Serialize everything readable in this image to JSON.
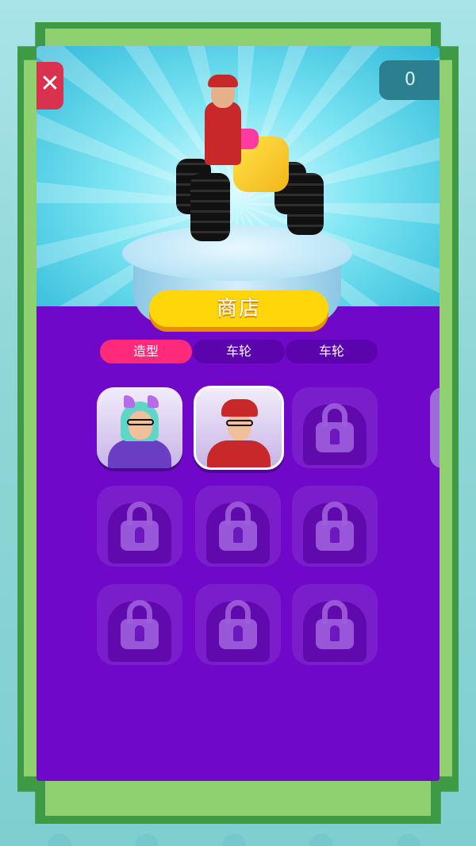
{
  "header": {
    "close_label": "✕",
    "coin_count": "0"
  },
  "shop": {
    "title": "商店"
  },
  "tabs": [
    {
      "label": "造型",
      "active": true
    },
    {
      "label": "车轮",
      "active": false
    },
    {
      "label": "车轮",
      "active": false
    }
  ],
  "grid": {
    "rows": 3,
    "cols": 3,
    "items": [
      {
        "state": "unlocked",
        "icon": "character-avatar-teal-hair-headphones",
        "selected": false
      },
      {
        "state": "unlocked",
        "icon": "character-avatar-red-cap",
        "selected": true
      },
      {
        "state": "locked",
        "icon": "lock-icon"
      },
      {
        "state": "locked",
        "icon": "lock-icon"
      },
      {
        "state": "locked",
        "icon": "lock-icon"
      },
      {
        "state": "locked",
        "icon": "lock-icon"
      },
      {
        "state": "locked",
        "icon": "lock-icon"
      },
      {
        "state": "locked",
        "icon": "lock-icon"
      },
      {
        "state": "locked",
        "icon": "lock-icon"
      }
    ]
  },
  "colors": {
    "frame_green": "#8fd170",
    "frame_dark": "#3f9a46",
    "panel_purple": "#6f08c8",
    "title_yellow": "#fed60a",
    "tab_active_pink": "#ff2a7a",
    "close_red": "#d8324e",
    "coin_teal": "#2b7f8e"
  }
}
